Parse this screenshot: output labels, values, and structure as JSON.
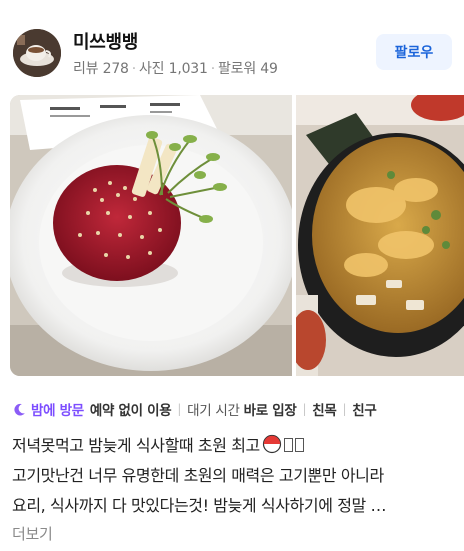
{
  "user": {
    "name": "미쓰뱅뱅",
    "stats": [
      "리뷰 278",
      "사진 1,031",
      "팔로워 49"
    ],
    "follow_label": "팔로우"
  },
  "photos": [
    "steak-tartare-photo",
    "stew-photo"
  ],
  "tags": {
    "visit_time": "밤에 방문",
    "reservation": "예약 없이 이용",
    "wait_prefix": "대기 시간",
    "wait_value": "바로 입장",
    "purpose": "친목",
    "companion": "친구"
  },
  "review": {
    "line1": "저녁못먹고 밤늦게 식사할때 초원 최고",
    "line2": "고기맛난건 너무 유명한데 초원의 매력은 고기뿐만 아니라",
    "line3": "요리, 식사까지 다 맛있다는것! 밤늦게 식사하기에 정말 …"
  },
  "more_label": "더보기",
  "colors": {
    "accent": "#1b64da",
    "night_tag": "#7c4dff",
    "follow_bg": "#eef4ff"
  }
}
